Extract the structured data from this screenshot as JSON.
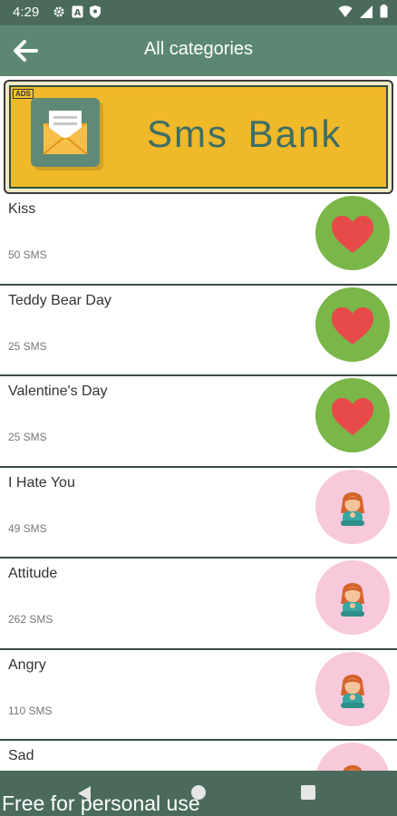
{
  "status_bar": {
    "time": "4:29",
    "icons_left": [
      "gear-icon",
      "a-box-icon",
      "shield-icon"
    ],
    "icons_right": [
      "wifi-icon",
      "signal-icon",
      "battery-icon"
    ]
  },
  "app_bar": {
    "back_icon": "arrow-left-icon",
    "title": "All categories"
  },
  "banner": {
    "badge": "ADS",
    "title": "Sms  Bank",
    "colors": {
      "background": "#f0b92a",
      "title": "#3d6e64",
      "logo_bg": "#5f8a78"
    }
  },
  "categories": [
    {
      "name": "Kiss",
      "count": "50 SMS",
      "icon": "heart-icon"
    },
    {
      "name": "Teddy Bear Day",
      "count": "25 SMS",
      "icon": "heart-icon"
    },
    {
      "name": "Valentine's Day",
      "count": "25 SMS",
      "icon": "heart-icon"
    },
    {
      "name": "I Hate You",
      "count": "49 SMS",
      "icon": "sad-girl-icon"
    },
    {
      "name": "Attitude",
      "count": "262 SMS",
      "icon": "sad-girl-icon"
    },
    {
      "name": "Angry",
      "count": "110 SMS",
      "icon": "sad-girl-icon"
    },
    {
      "name": "Sad",
      "count": "",
      "icon": "sad-girl-icon"
    }
  ],
  "nav_bar": {
    "icons": [
      "nav-back-icon",
      "nav-home-icon",
      "nav-recents-icon"
    ]
  },
  "watermark": "Free for personal use",
  "colors": {
    "status_bar": "#4a6b5c",
    "app_bar": "#5b8773",
    "heart_bg": "#7ab648",
    "heart": "#e84a4a",
    "girl_bg": "#f7c9db"
  }
}
